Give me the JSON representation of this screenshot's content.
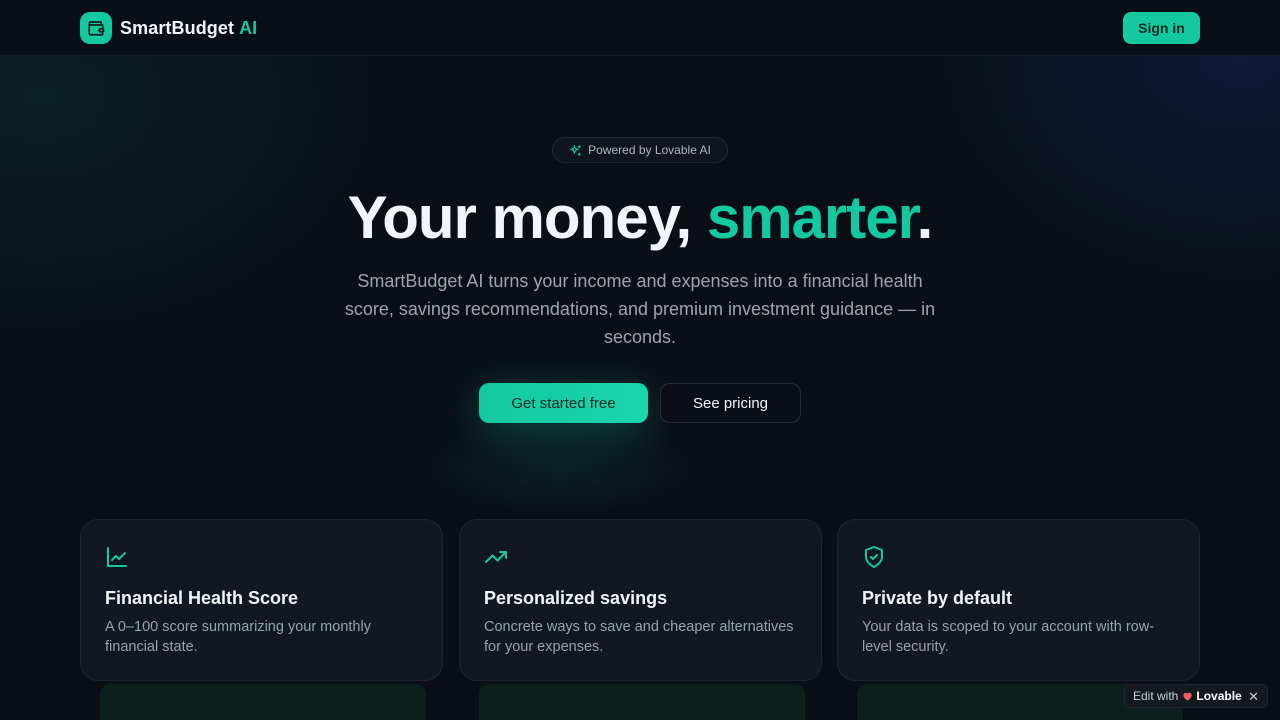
{
  "header": {
    "brand_name": "SmartBudget",
    "brand_accent": "AI",
    "signin_label": "Sign in"
  },
  "hero": {
    "badge_text": "Powered by Lovable AI",
    "title_main": "Your money, ",
    "title_accent": "smarter",
    "title_end": ".",
    "subtitle": "SmartBudget AI turns your income and expenses into a financial health score, savings recommendations, and premium investment guidance — in seconds.",
    "primary_cta": "Get started free",
    "secondary_cta": "See pricing"
  },
  "features": [
    {
      "icon": "line-chart-icon",
      "title": "Financial Health Score",
      "description": "A 0–100 score summarizing your monthly financial state."
    },
    {
      "icon": "trending-up-icon",
      "title": "Personalized savings",
      "description": "Concrete ways to save and cheaper alternatives for your expenses."
    },
    {
      "icon": "shield-check-icon",
      "title": "Private by default",
      "description": "Your data is scoped to your account with row-level security."
    }
  ],
  "edit_bar": {
    "prefix": "Edit with",
    "brand": "Lovable",
    "close": "✕"
  },
  "colors": {
    "accent": "#14c9a0",
    "background": "#0a0f17",
    "card": "#111824"
  }
}
